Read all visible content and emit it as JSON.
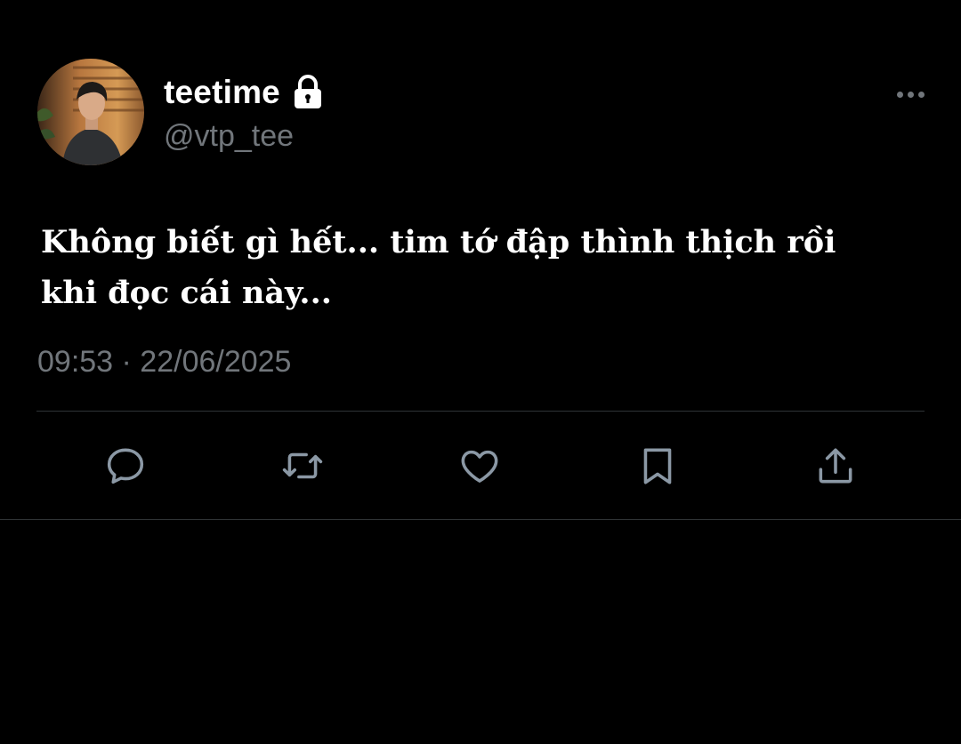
{
  "tweet": {
    "display_name": "teetime",
    "handle": "@vtp_tee",
    "text": "Không biết gì hết... tim tớ đập thình thịch rồi\nkhi đọc cái này...",
    "timestamp": "09:53 · 22/06/2025",
    "protected": true
  },
  "icons": {
    "lock": "lock-icon",
    "more": "more-horizontal-icon",
    "reply": "reply-icon",
    "retweet": "retweet-icon",
    "like": "heart-icon",
    "bookmark": "bookmark-icon",
    "share": "share-icon"
  },
  "colors": {
    "background": "#000000",
    "primary_text": "#ffffff",
    "secondary_text": "#71767b",
    "divider": "#2f3336",
    "icon": "#8b98a5"
  }
}
